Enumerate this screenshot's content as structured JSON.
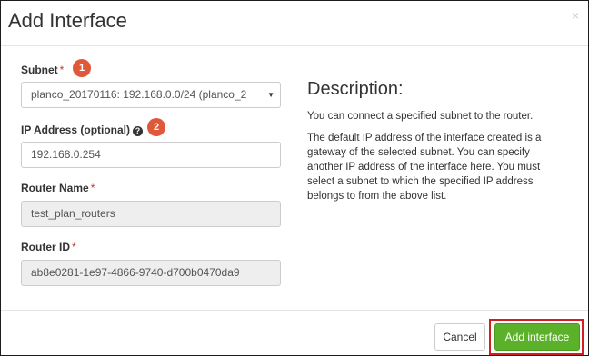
{
  "modal": {
    "title": "Add Interface",
    "close_glyph": "×"
  },
  "form": {
    "subnet": {
      "label": "Subnet",
      "required_mark": "*",
      "badge": "1",
      "value": "planco_20170116: 192.168.0.0/24 (planco_2",
      "caret": "▼"
    },
    "ip_address": {
      "label": "IP Address (optional)",
      "help_glyph": "?",
      "badge": "2",
      "value": "192.168.0.254"
    },
    "router_name": {
      "label": "Router Name",
      "required_mark": "*",
      "value": "test_plan_routers"
    },
    "router_id": {
      "label": "Router ID",
      "required_mark": "*",
      "value": "ab8e0281-1e97-4866-9740-d700b0470da9"
    }
  },
  "description": {
    "title": "Description:",
    "paragraph1": "You can connect a specified subnet to the router.",
    "paragraph2": "The default IP address of the interface created is a gateway of the selected subnet. You can specify another IP address of the interface here. You must select a subnet to which the specified IP address belongs to from the above list."
  },
  "footer": {
    "cancel_label": "Cancel",
    "submit_label": "Add interface"
  },
  "colors": {
    "badge": "#e0583a",
    "submit": "#5cb12a",
    "highlight_border": "#d11f1f"
  }
}
